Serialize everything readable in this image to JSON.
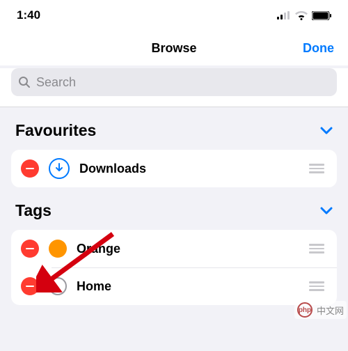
{
  "statusbar": {
    "time": "1:40"
  },
  "nav": {
    "title": "Browse",
    "done": "Done"
  },
  "search": {
    "placeholder": "Search"
  },
  "sections": {
    "favourites": {
      "title": "Favourites",
      "items": [
        {
          "label": "Downloads",
          "icon": "download"
        }
      ]
    },
    "tags": {
      "title": "Tags",
      "items": [
        {
          "label": "Orange",
          "color": "orange"
        },
        {
          "label": "Home",
          "color": "hollow"
        }
      ]
    }
  },
  "watermark": {
    "logo": "php",
    "text": "中文网"
  }
}
